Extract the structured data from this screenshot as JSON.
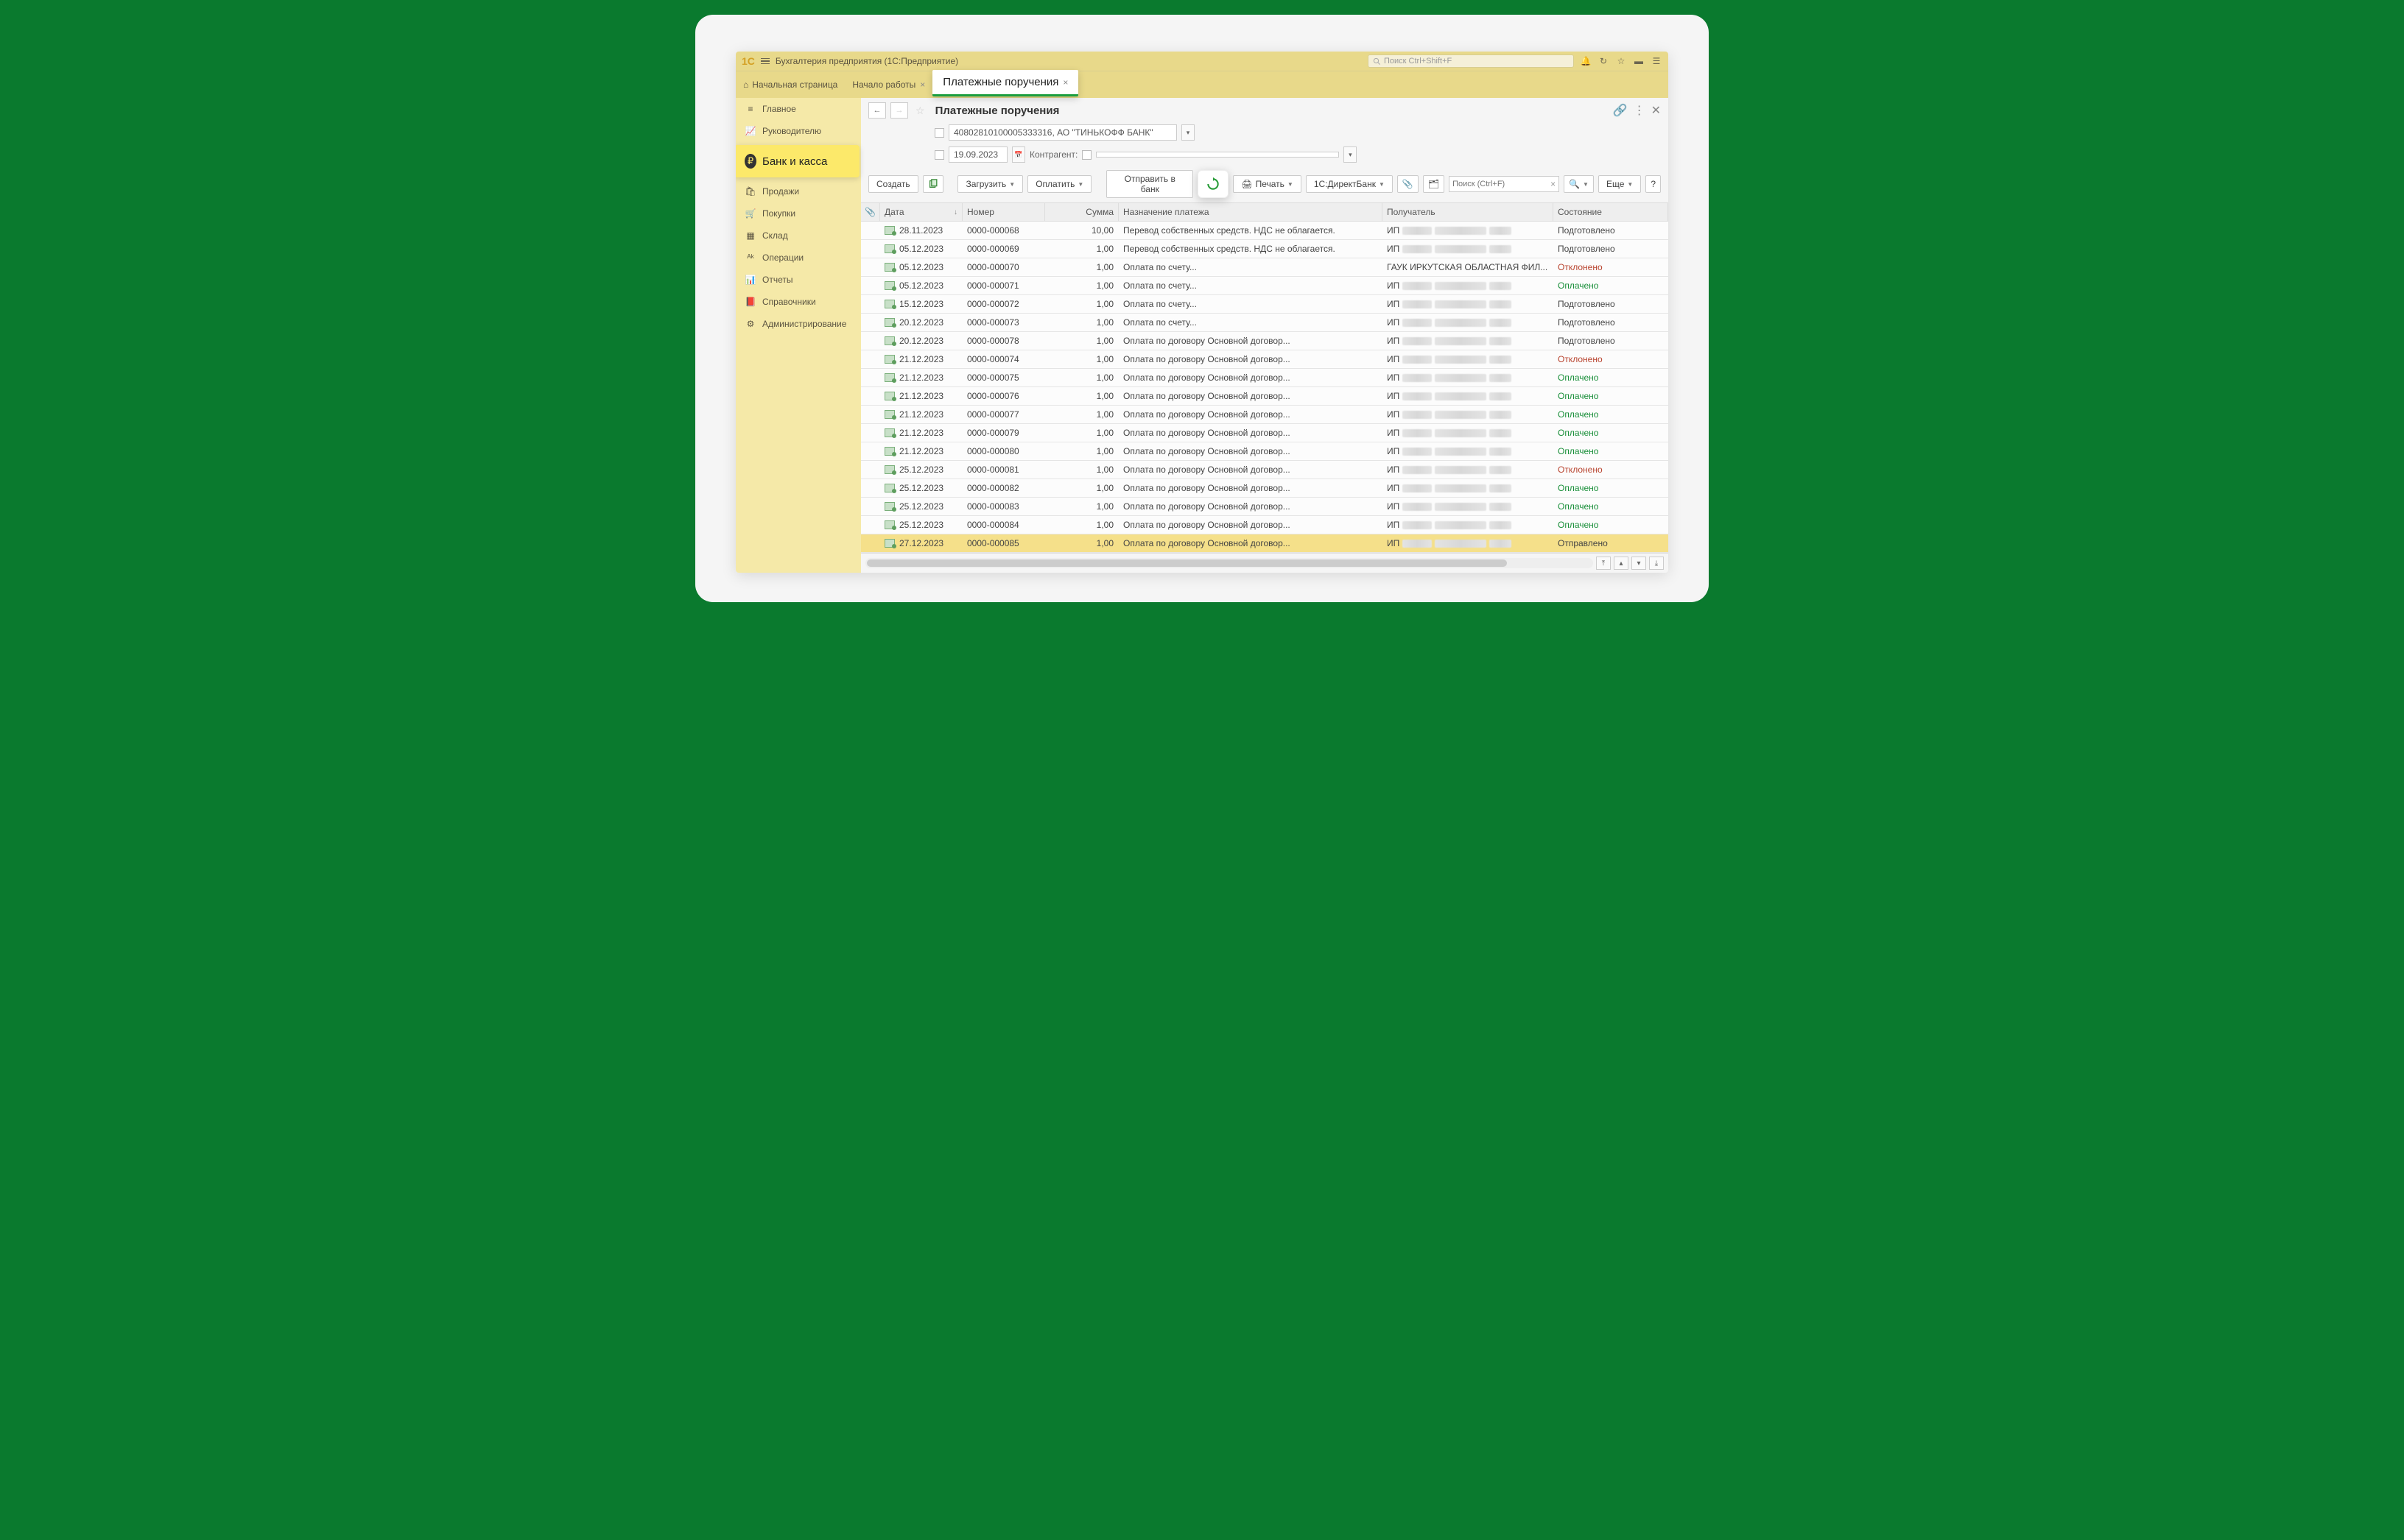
{
  "header": {
    "app_title": "Бухгалтерия предприятия  (1С:Предприятие)",
    "search_placeholder": "Поиск Ctrl+Shift+F"
  },
  "tabs": {
    "home": "Начальная страница",
    "start": "Начало работы",
    "payments": "Платежные поручения"
  },
  "sidebar": {
    "items": [
      {
        "icon": "menu",
        "label": "Главное"
      },
      {
        "icon": "trend",
        "label": "Руководителю"
      },
      {
        "icon": "ruble",
        "label": "Банк и касса",
        "emph": true
      },
      {
        "icon": "bag",
        "label": "Продажи"
      },
      {
        "icon": "cart",
        "label": "Покупки"
      },
      {
        "icon": "boxes",
        "label": "Склад"
      },
      {
        "icon": "ops",
        "label": "Операции"
      },
      {
        "icon": "chart",
        "label": "Отчеты"
      },
      {
        "icon": "book",
        "label": "Справочники"
      },
      {
        "icon": "gear",
        "label": "Администрирование"
      }
    ]
  },
  "page": {
    "title": "Платежные поручения",
    "filters": {
      "bank_account": "40802810100005333316, АО \"ТИНЬКОФФ БАНК\"",
      "date": "19.09.2023",
      "counterparty_label": "Контрагент:"
    },
    "toolbar": {
      "create": "Создать",
      "upload": "Загрузить",
      "pay": "Оплатить",
      "send_bank": "Отправить в банк",
      "print": "Печать",
      "directbank": "1С:ДиректБанк",
      "search_placeholder": "Поиск (Ctrl+F)",
      "more": "Еще"
    },
    "columns": {
      "date": "Дата",
      "number": "Номер",
      "sum": "Сумма",
      "desc": "Назначение платежа",
      "recipient": "Получатель",
      "status": "Состояние"
    },
    "status_labels": {
      "prep": "Подготовлено",
      "rej": "Отклонено",
      "paid": "Оплачено",
      "sent": "Отправлено"
    },
    "rows": [
      {
        "date": "28.11.2023",
        "number": "0000-000068",
        "sum": "10,00",
        "desc": "Перевод собственных средств. НДС не облагается.",
        "recipient_prefix": "ИП",
        "status": "prep"
      },
      {
        "date": "05.12.2023",
        "number": "0000-000069",
        "sum": "1,00",
        "desc": "Перевод собственных средств. НДС не облагается.",
        "recipient_prefix": "ИП",
        "status": "prep"
      },
      {
        "date": "05.12.2023",
        "number": "0000-000070",
        "sum": "1,00",
        "desc": "Оплата по счету...",
        "recipient_prefix": "ГАУК ИРКУТСКАЯ ОБЛАСТНАЯ ФИЛ...",
        "status": "rej"
      },
      {
        "date": "05.12.2023",
        "number": "0000-000071",
        "sum": "1,00",
        "desc": "Оплата по счету...",
        "recipient_prefix": "ИП",
        "status": "paid"
      },
      {
        "date": "15.12.2023",
        "number": "0000-000072",
        "sum": "1,00",
        "desc": "Оплата по счету...",
        "recipient_prefix": "ИП",
        "status": "prep"
      },
      {
        "date": "20.12.2023",
        "number": "0000-000073",
        "sum": "1,00",
        "desc": "Оплата по счету...",
        "recipient_prefix": "ИП",
        "status": "prep"
      },
      {
        "date": "20.12.2023",
        "number": "0000-000078",
        "sum": "1,00",
        "desc": "Оплата по договору Основной договор...",
        "recipient_prefix": "ИП",
        "status": "prep"
      },
      {
        "date": "21.12.2023",
        "number": "0000-000074",
        "sum": "1,00",
        "desc": "Оплата по договору Основной договор...",
        "recipient_prefix": "ИП",
        "status": "rej"
      },
      {
        "date": "21.12.2023",
        "number": "0000-000075",
        "sum": "1,00",
        "desc": "Оплата по договору Основной договор...",
        "recipient_prefix": "ИП",
        "status": "paid"
      },
      {
        "date": "21.12.2023",
        "number": "0000-000076",
        "sum": "1,00",
        "desc": "Оплата по договору Основной договор...",
        "recipient_prefix": "ИП",
        "status": "paid"
      },
      {
        "date": "21.12.2023",
        "number": "0000-000077",
        "sum": "1,00",
        "desc": "Оплата по договору Основной договор...",
        "recipient_prefix": "ИП",
        "status": "paid"
      },
      {
        "date": "21.12.2023",
        "number": "0000-000079",
        "sum": "1,00",
        "desc": "Оплата по договору Основной договор...",
        "recipient_prefix": "ИП",
        "status": "paid"
      },
      {
        "date": "21.12.2023",
        "number": "0000-000080",
        "sum": "1,00",
        "desc": "Оплата по договору Основной договор...",
        "recipient_prefix": "ИП",
        "status": "paid"
      },
      {
        "date": "25.12.2023",
        "number": "0000-000081",
        "sum": "1,00",
        "desc": "Оплата по договору Основной договор...",
        "recipient_prefix": "ИП",
        "status": "rej"
      },
      {
        "date": "25.12.2023",
        "number": "0000-000082",
        "sum": "1,00",
        "desc": "Оплата по договору Основной договор...",
        "recipient_prefix": "ИП",
        "status": "paid"
      },
      {
        "date": "25.12.2023",
        "number": "0000-000083",
        "sum": "1,00",
        "desc": "Оплата по договору Основной договор...",
        "recipient_prefix": "ИП",
        "status": "paid"
      },
      {
        "date": "25.12.2023",
        "number": "0000-000084",
        "sum": "1,00",
        "desc": "Оплата по договору Основной договор...",
        "recipient_prefix": "ИП",
        "status": "paid"
      },
      {
        "date": "27.12.2023",
        "number": "0000-000085",
        "sum": "1,00",
        "desc": "Оплата по договору Основной договор...",
        "recipient_prefix": "ИП",
        "status": "sent",
        "selected": true
      }
    ]
  }
}
